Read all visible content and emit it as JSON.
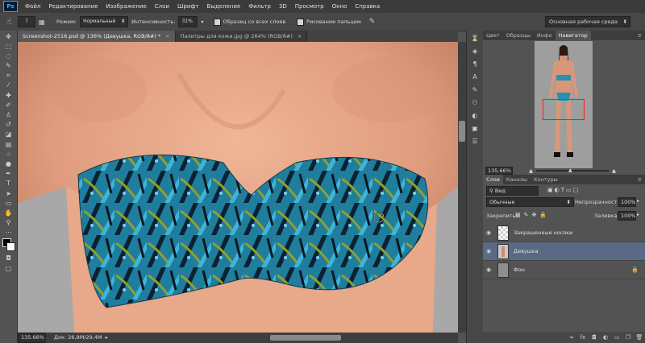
{
  "app": {
    "logo": "Ps"
  },
  "menu": [
    "Файл",
    "Редактирование",
    "Изображение",
    "Слои",
    "Шрифт",
    "Выделение",
    "Фильтр",
    "3D",
    "Просмотр",
    "Окно",
    "Справка"
  ],
  "options": {
    "brush_size": "7",
    "mode_label": "Режим:",
    "mode_value": "Нормальный",
    "intensity_label": "Интенсивность:",
    "intensity_value": "31%",
    "sample_all_label": "Образец со всех слоев",
    "finger_label": "Рисование пальцем",
    "workspace": "Основная рабочая среда"
  },
  "tabs": [
    {
      "label": "Screenshot-2516.psd @ 136% (Девушка, RGB/8#) *"
    },
    {
      "label": "Палитры для кожи.jpg @ 264% (RGB/8#)"
    }
  ],
  "status": {
    "zoom": "135.66%",
    "doc": "Док: 26,8M/29,4M"
  },
  "navigator": {
    "tabs": [
      "Цвет",
      "Образцы",
      "Инфо",
      "Навигатор"
    ],
    "zoom": "135.66%"
  },
  "layers_panel": {
    "tabs": [
      "Слои",
      "Каналы",
      "Контуры"
    ],
    "filter": "Вид",
    "blend_mode": "Обычные",
    "opacity_label": "Непрозрачность:",
    "opacity_value": "100%",
    "lock_label": "Закрепить:",
    "fill_label": "Заливка:",
    "fill_value": "100%",
    "layers": [
      {
        "name": "Закрашенные косяки",
        "selected": false
      },
      {
        "name": "Девушка",
        "selected": true
      },
      {
        "name": "Фон",
        "selected": false
      }
    ]
  },
  "colors": {
    "selected_layer": "#5a6a84",
    "skin": "#e3a184",
    "bikini": "#2a8fb0"
  }
}
